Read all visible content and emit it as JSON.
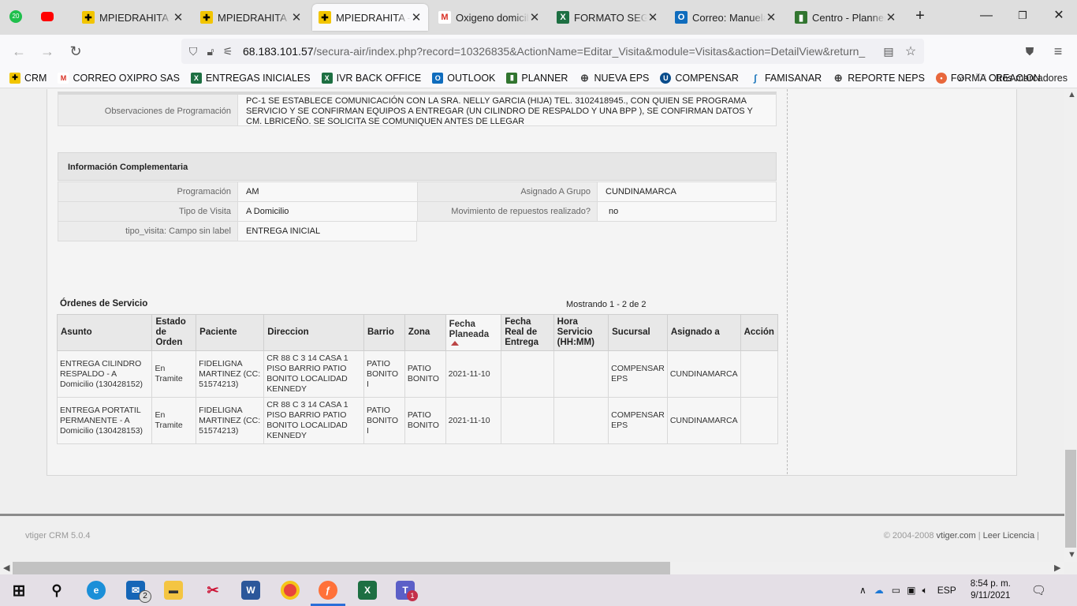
{
  "browser": {
    "tabs": [
      {
        "label": "MPIEDRAHITA - A",
        "active": false
      },
      {
        "label": "MPIEDRAHITA - A",
        "active": false
      },
      {
        "label": "MPIEDRAHITA - A",
        "active": true
      },
      {
        "label": "Oxigeno domicilia",
        "active": false
      },
      {
        "label": "FORMATO SEGUIM",
        "active": false
      },
      {
        "label": "Correo: Manuela F",
        "active": false
      },
      {
        "label": "Centro - Planner",
        "active": false
      }
    ],
    "badge_count": "20",
    "url_host": "68.183.101.57",
    "url_rest": "/secura-air/index.php?record=10326835&ActionName=Editar_Visita&module=Visitas&action=DetailView&return_",
    "bookmarks": [
      "CRM",
      "CORREO OXIPRO SAS",
      "ENTREGAS INICIALES",
      "IVR BACK OFFICE",
      "OUTLOOK",
      "PLANNER",
      "NUEVA EPS",
      "COMPENSAR",
      "FAMISANAR",
      "REPORTE NEPS",
      "FORMA CREACION"
    ],
    "other_bookmarks": "Otros marcadores"
  },
  "detail": {
    "obs_label": "Observaciones de Programación",
    "obs_value": "PC-1 SE ESTABLECE COMUNICACIÓN CON LA SRA. NELLY GARCIA (HIJA) TEL. 3102418945., CON QUIEN SE PROGRAMA SERVICIO Y SE CONFIRMAN EQUIPOS A ENTREGAR (UN CILINDRO DE RESPALDO Y UNA BPP ), SE CONFIRMAN DATOS Y CM. LBRICEÑO. SE SOLICITA SE COMUNIQUEN ANTES DE LLEGAR",
    "section_title": "Información Complementaria",
    "programacion_label": "Programación",
    "programacion_value": "AM",
    "asignado_label": "Asignado A Grupo",
    "asignado_value": "CUNDINAMARCA",
    "tipo_label": "Tipo de Visita",
    "tipo_value": "A Domicilio",
    "movimiento_label": "Movimiento de repuestos realizado?",
    "movimiento_value": "no",
    "tipo_visita_label": "tipo_visita: Campo sin label",
    "tipo_visita_value": "ENTREGA INICIAL"
  },
  "orders": {
    "title": "Órdenes de Servicio",
    "count": "Mostrando 1 - 2 de 2",
    "columns": {
      "asunto": "Asunto",
      "estado": "Estado de Orden",
      "paciente": "Paciente",
      "direccion": "Direccion",
      "barrio": "Barrio",
      "zona": "Zona",
      "fecha_planeada": "Fecha Planeada",
      "fecha_real": "Fecha Real de Entrega",
      "hora": "Hora Servicio (HH:MM)",
      "sucursal": "Sucursal",
      "asignado": "Asignado a",
      "accion": "Acción"
    },
    "rows": [
      {
        "asunto": "ENTREGA CILINDRO RESPALDO - A Domicilio (130428152)",
        "estado": "En Tramite",
        "paciente": "FIDELIGNA MARTINEZ (CC: 51574213)",
        "direccion": "CR 88 C 3 14 CASA 1 PISO BARRIO PATIO BONITO LOCALIDAD KENNEDY",
        "barrio": "PATIO BONITO I",
        "zona": "PATIO BONITO",
        "fecha_planeada": "2021-11-10",
        "fecha_real": "",
        "hora": "",
        "sucursal": "COMPENSAR EPS",
        "asignado": "CUNDINAMARCA",
        "accion": ""
      },
      {
        "asunto": "ENTREGA PORTATIL PERMANENTE - A Domicilio (130428153)",
        "estado": "En Tramite",
        "paciente": "FIDELIGNA MARTINEZ (CC: 51574213)",
        "direccion": "CR 88 C 3 14 CASA 1 PISO BARRIO PATIO BONITO LOCALIDAD KENNEDY",
        "barrio": "PATIO BONITO I",
        "zona": "PATIO BONITO",
        "fecha_planeada": "2021-11-10",
        "fecha_real": "",
        "hora": "",
        "sucursal": "COMPENSAR EPS",
        "asignado": "CUNDINAMARCA",
        "accion": ""
      }
    ]
  },
  "footer": {
    "left": "vtiger CRM 5.0.4",
    "right_prefix": "© 2004-2008",
    "right_link": "vtiger.com",
    "right_sep": "|",
    "right_license": "Leer Licencia",
    "right_end": "|"
  },
  "taskbar": {
    "mail_badge": "2",
    "teams_badge": "1",
    "lang": "ESP",
    "time": "8:54 p. m.",
    "date": "9/11/2021"
  },
  "colors": {
    "crm_yellow": "#f2c500",
    "gmail_red": "#d93025",
    "excel_green": "#1d6f42",
    "outlook_blue": "#0f6cbd",
    "planner_green": "#31752f",
    "sort_red": "#b44444"
  }
}
